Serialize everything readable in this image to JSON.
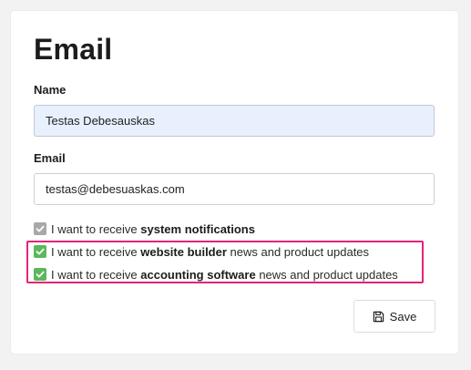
{
  "page": {
    "title": "Email"
  },
  "form": {
    "name_label": "Name",
    "name_value": "Testas Debesauskas",
    "email_label": "Email",
    "email_value": "testas@debesuaskas.com"
  },
  "checkboxes": [
    {
      "prefix": "I want to receive ",
      "bold": "system notifications",
      "suffix": "",
      "checked": true,
      "state": "disabled",
      "color": "#a8a8a8"
    },
    {
      "prefix": "I want to receive ",
      "bold": "website builder",
      "suffix": " news and product updates",
      "checked": true,
      "state": "enabled",
      "color": "#5cb85c"
    },
    {
      "prefix": "I want to receive ",
      "bold": "accounting software",
      "suffix": " news and product updates",
      "checked": true,
      "state": "enabled",
      "color": "#5cb85c"
    }
  ],
  "actions": {
    "save_label": "Save",
    "save_icon": "floppy-disk-icon"
  },
  "colors": {
    "highlight": "#e0247a",
    "checkbox_checked": "#5cb85c",
    "checkbox_disabled": "#a8a8a8",
    "autofill_bg": "#e8f0fe"
  }
}
